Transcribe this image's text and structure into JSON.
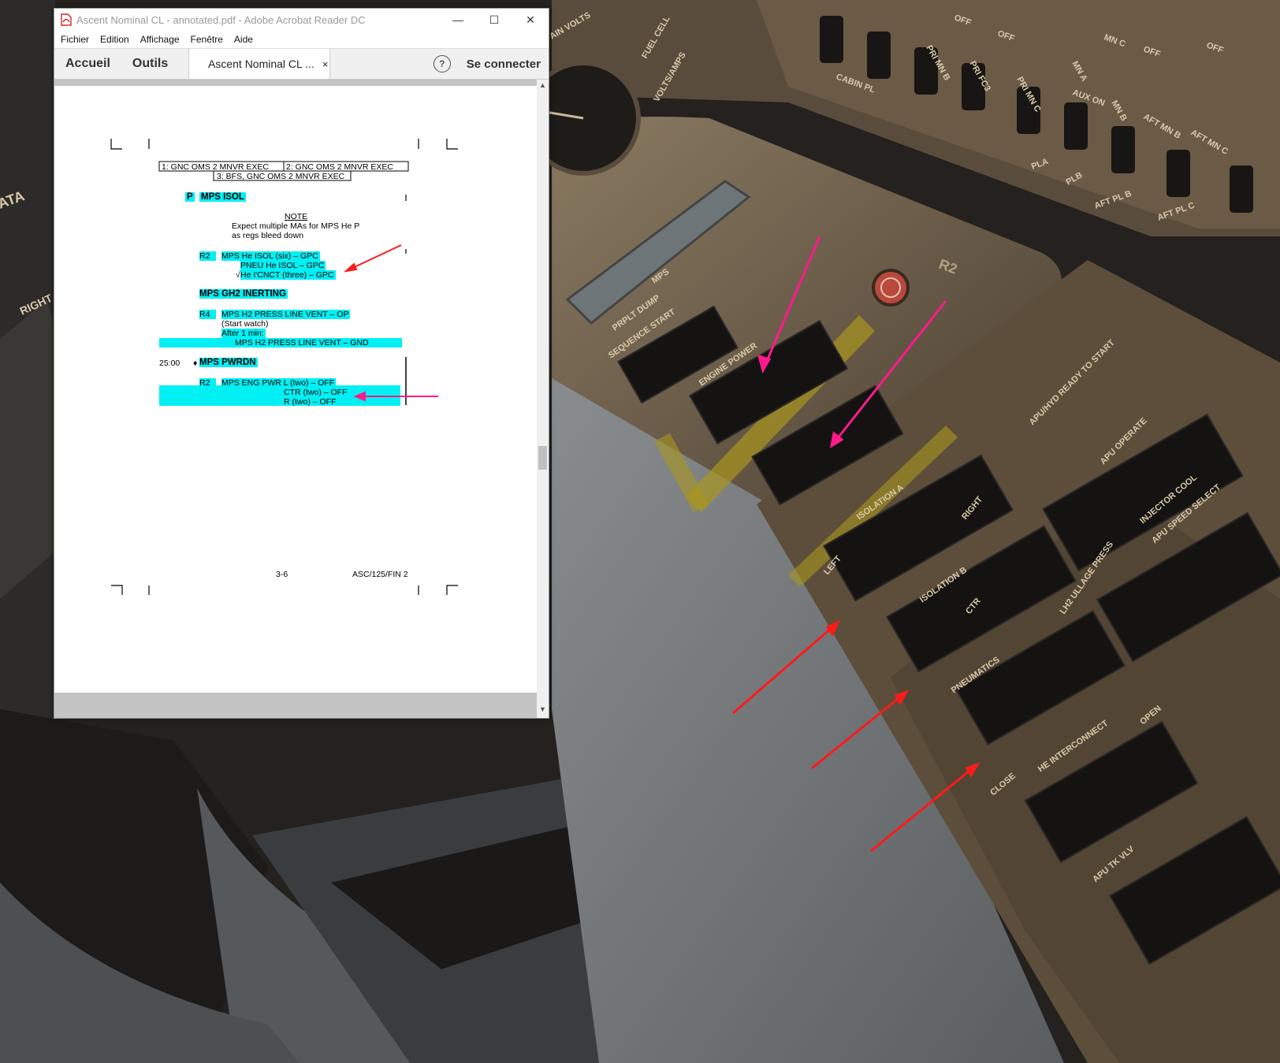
{
  "window": {
    "title": "Ascent Nominal CL - annotated.pdf - Adobe Acrobat Reader DC",
    "min_glyph": "—",
    "max_glyph": "☐",
    "close_glyph": "✕"
  },
  "menu": [
    "Fichier",
    "Edition",
    "Affichage",
    "Fenêtre",
    "Aide"
  ],
  "toolbar": {
    "home": "Accueil",
    "tools": "Outils",
    "doc_tab": "Ascent Nominal CL ...",
    "doc_tab_close": "×",
    "help": "?",
    "signin": "Se connecter"
  },
  "pdf": {
    "boxes": {
      "b1": "1:  GNC OMS 2 MNVR EXEC",
      "b2": "2:  GNC OMS 2 MNVR EXEC",
      "b3": "3:  BFS, GNC OMS 2 MNVR EXEC"
    },
    "isol_p": "P",
    "isol_title": "MPS ISOL",
    "note_title": "NOTE",
    "note_l1": "Expect multiple MAs for MPS He P",
    "note_l2": "as regs bleed down",
    "r2a": "R2",
    "r2a_l1": "MPS He ISOL (six)       – GPC",
    "r2a_l2": "PNEU He ISOL     – GPC",
    "r2a_l3_mark": "√",
    "r2a_l3": "He I'CNCT (three) – GPC",
    "inert_title": "MPS GH2 INERTING",
    "r4": "R4",
    "r4_l1": "MPS H2 PRESS LINE VENT – OP",
    "r4_l2": "(Start watch)",
    "r4_l3": "After 1 min:",
    "r4_l4": "MPS H2 PRESS LINE VENT – GND",
    "time": "25:00",
    "bullet": "♦",
    "pwrdn_title": "MPS PWRDN",
    "r2b": "R2",
    "r2b_l1": "MPS ENG PWR L (two)      – OFF",
    "r2b_l2": "CTR (two) – OFF",
    "r2b_l3": "R (two)     – OFF",
    "page_no": "3-6",
    "doc_id": "ASC/125/FIN 2"
  },
  "panel": {
    "id_label": "R2",
    "labels": [
      "AIN VOLTS",
      "FUEL CELL",
      "VOLTS/AMPS",
      "OFF",
      "OFF",
      "OFF",
      "OFF",
      "PRI MN B",
      "PRI FC3",
      "PRI MN C",
      "MN A",
      "MN B",
      "MN C",
      "AUX ON",
      "AFT MN B",
      "AFT MN C",
      "CABIN PL",
      "AFT PL B",
      "AFT PL C",
      "PLA",
      "PLB",
      "MPS",
      "PRPLT DUMP",
      "SEQUENCE START",
      "ENGINE POWER",
      "ISOLATION A",
      "ISOLATION B",
      "PNEUMATICS",
      "HE INTERCONNECT",
      "LH2 ULLAGE PRESS",
      "APU/HYD READY TO START",
      "APU OPERATE",
      "INJECTOR COOL",
      "APU SPEED SELECT",
      "APU TK VLV",
      "CLOSE",
      "OPEN",
      "LEFT",
      "CTR",
      "RIGHT",
      "ATA",
      "RIGHT"
    ]
  },
  "colors": {
    "highlight": "#00f0f4",
    "arrow_red": "#ff1a1a",
    "arrow_pink": "#ff1a8c"
  }
}
